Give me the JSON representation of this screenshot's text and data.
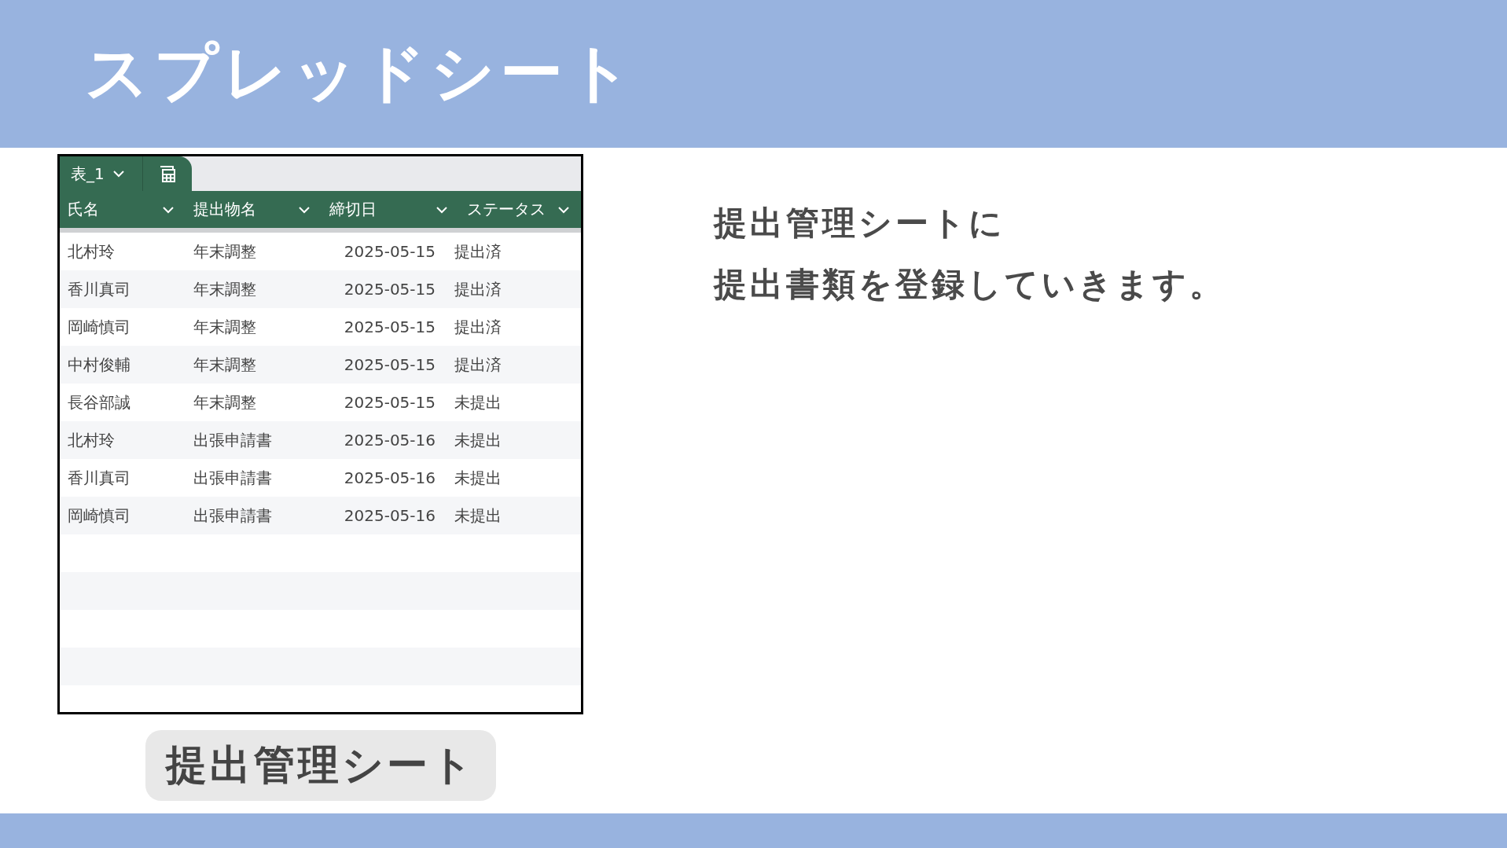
{
  "title": "スプレッドシート",
  "sheet": {
    "tab": {
      "label": "表_1",
      "selected": true
    },
    "columns": [
      "氏名",
      "提出物名",
      "締切日",
      "ステータス"
    ],
    "rows": [
      [
        "北村玲",
        "年末調整",
        "2025-05-15",
        "提出済"
      ],
      [
        "香川真司",
        "年末調整",
        "2025-05-15",
        "提出済"
      ],
      [
        "岡崎慎司",
        "年末調整",
        "2025-05-15",
        "提出済"
      ],
      [
        "中村俊輔",
        "年末調整",
        "2025-05-15",
        "提出済"
      ],
      [
        "長谷部誠",
        "年末調整",
        "2025-05-15",
        "未提出"
      ],
      [
        "北村玲",
        "出張申請書",
        "2025-05-16",
        "未提出"
      ],
      [
        "香川真司",
        "出張申請書",
        "2025-05-16",
        "未提出"
      ],
      [
        "岡崎慎司",
        "出張申請書",
        "2025-05-16",
        "未提出"
      ]
    ]
  },
  "caption": "提出管理シート",
  "description": [
    "提出管理シートに",
    "提出書類を登録していきます。"
  ]
}
